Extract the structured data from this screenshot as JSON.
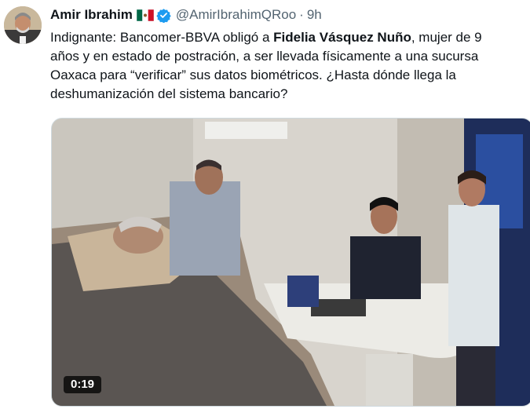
{
  "author": {
    "name": "Amir Ibrahim",
    "handle": "@AmirIbrahimQRoo",
    "separator": "·",
    "time": "9h",
    "flag_icon": "mexico-flag-icon",
    "verified_icon": "verified-badge-icon"
  },
  "tweet": {
    "line1_pre": "Indignante: Bancomer-BBVA obligó a ",
    "line1_bold": "Fidelia Vásquez Nuño",
    "line1_post": ", mujer de 9",
    "line2": "años y en estado de postración, a ser llevada físicamente a una sucursa",
    "line3": "Oaxaca para “verificar” sus datos biométricos. ¿Hasta dónde llega la",
    "line4": "deshumanización del sistema bancario?"
  },
  "media": {
    "duration": "0:19"
  },
  "colors": {
    "text": "#0f1419",
    "secondary": "#536471",
    "verified": "#1d9bf0",
    "border": "#cfd9de"
  }
}
